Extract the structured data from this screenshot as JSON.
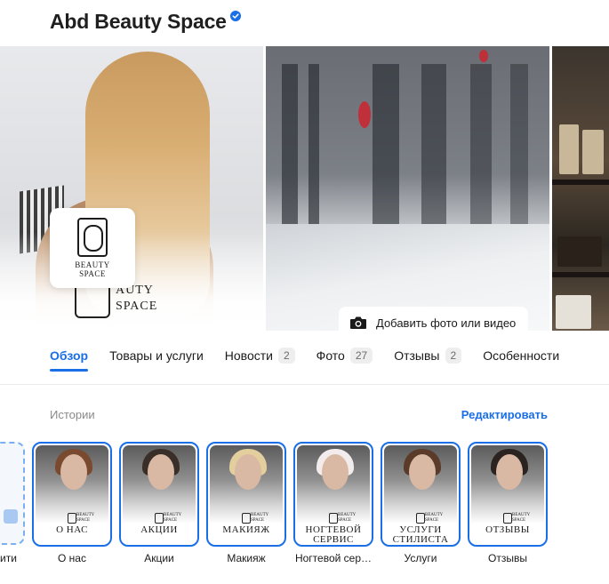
{
  "business": {
    "name": "Abd Beauty Space",
    "verified_icon": "verified-check-icon"
  },
  "gallery": {
    "logo_line1": "BEAUTY",
    "logo_line2": "SPACE",
    "watermark_line1": "AUTY",
    "watermark_line2": "SPACE",
    "add_media_label": "Добавить фото или видео",
    "add_media_icon": "camera-icon"
  },
  "tabs": [
    {
      "label": "Обзор",
      "count": null,
      "active": true
    },
    {
      "label": "Товары и услуги",
      "count": null
    },
    {
      "label": "Новости",
      "count": "2"
    },
    {
      "label": "Фото",
      "count": "27"
    },
    {
      "label": "Отзывы",
      "count": "2"
    },
    {
      "label": "Особенности",
      "count": null
    }
  ],
  "stories": {
    "title": "Истории",
    "edit_label": "Редактировать",
    "add_caption": "ити",
    "items": [
      {
        "thumb_label": "О НАС",
        "caption": "О нас"
      },
      {
        "thumb_label": "АКЦИИ",
        "caption": "Акции"
      },
      {
        "thumb_label": "МАКИЯЖ",
        "caption": "Макияж"
      },
      {
        "thumb_label": "НОГТЕВОЙ СЕРВИС",
        "caption": "Ногтевой сер…"
      },
      {
        "thumb_label": "УСЛУГИ СТИЛИСТА",
        "caption": "Услуги"
      },
      {
        "thumb_label": "ОТЗЫВЫ",
        "caption": "Отзывы"
      }
    ],
    "mini_logo_text": "BEAUTY SPACE"
  },
  "colors": {
    "accent": "#1a6ee6",
    "text": "#1a1a1a",
    "muted": "#8a8a8a"
  }
}
